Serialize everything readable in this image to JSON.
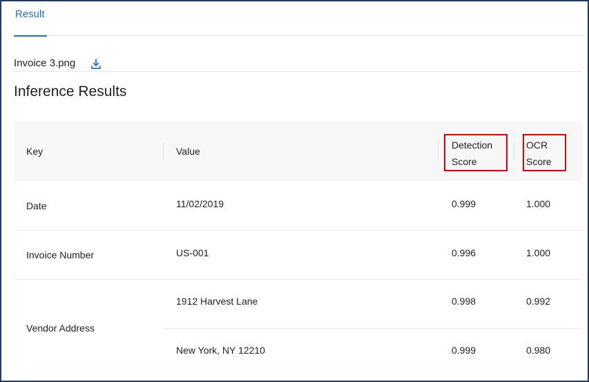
{
  "tabs": [
    {
      "label": "Result",
      "active": true
    }
  ],
  "file": {
    "name": "Invoice 3.png",
    "download_icon": "download-icon"
  },
  "heading": "Inference Results",
  "table": {
    "columns": {
      "key": "Key",
      "value": "Value",
      "detection_line1": "Detection",
      "detection_line2": "Score",
      "ocr_line1": "OCR",
      "ocr_line2": "Score"
    },
    "rows": [
      {
        "key": "Date",
        "value": "11/02/2019",
        "detection": "0.999",
        "ocr": "1.000"
      },
      {
        "key": "Invoice Number",
        "value": "US-001",
        "detection": "0.996",
        "ocr": "1.000"
      },
      {
        "key": "Vendor Address",
        "values": [
          {
            "value": "1912 Harvest Lane",
            "detection": "0.998",
            "ocr": "0.992"
          },
          {
            "value": "New York, NY 12210",
            "detection": "0.999",
            "ocr": "0.980"
          }
        ]
      }
    ]
  },
  "colors": {
    "accent": "#1a73c7",
    "highlight_box": "#e00000",
    "frame_border": "#1f3864",
    "header_bg": "#f7f7f7"
  }
}
